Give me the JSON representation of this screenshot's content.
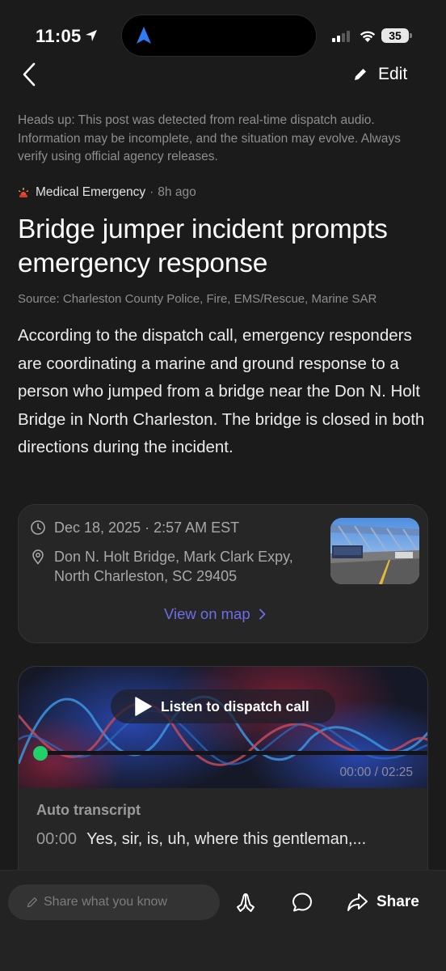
{
  "status_bar": {
    "time": "11:05",
    "battery": "35"
  },
  "nav": {
    "edit_label": "Edit"
  },
  "post": {
    "disclaimer": "Heads up: This post was detected from real-time dispatch audio. Information may be incomplete, and the situation may evolve. Always verify using official agency releases.",
    "category": "Medical Emergency",
    "category_separator": "·",
    "age": "8h ago",
    "headline": "Bridge jumper incident prompts emergency response",
    "source": "Source: Charleston County Police, Fire, EMS/Rescue, Marine SAR",
    "body": "According to the dispatch call, emergency responders are coordinating a marine and ground response to a person who jumped from a bridge near the Don N. Holt Bridge in North Charleston. The bridge is closed in both directions during the incident."
  },
  "info_card": {
    "datetime": "Dec 18, 2025 · 2:57 AM EST",
    "location": "Don N. Holt Bridge, Mark Clark Expy, North Charleston, SC 29405",
    "view_map_label": "View on map",
    "thumbnail_icon": "bridge-photo"
  },
  "audio": {
    "listen_label": "Listen to dispatch call",
    "time_readout": "00:00 / 02:25",
    "progress": 0,
    "transcript_heading": "Auto transcript",
    "transcript_time": "00:00",
    "transcript_text": "Yes, sir, is, uh, where this gentleman,...",
    "accent_color": "#22d06a"
  },
  "bottom_bar": {
    "share_placeholder": "Share what you know",
    "share_label": "Share",
    "icons": [
      "pencil-icon",
      "prayer-hands-icon",
      "comment-icon",
      "share-arrow-icon"
    ]
  },
  "colors": {
    "background": "#1b1b1b",
    "link": "#6d6ee8",
    "muted_text": "#8e8e8e"
  }
}
